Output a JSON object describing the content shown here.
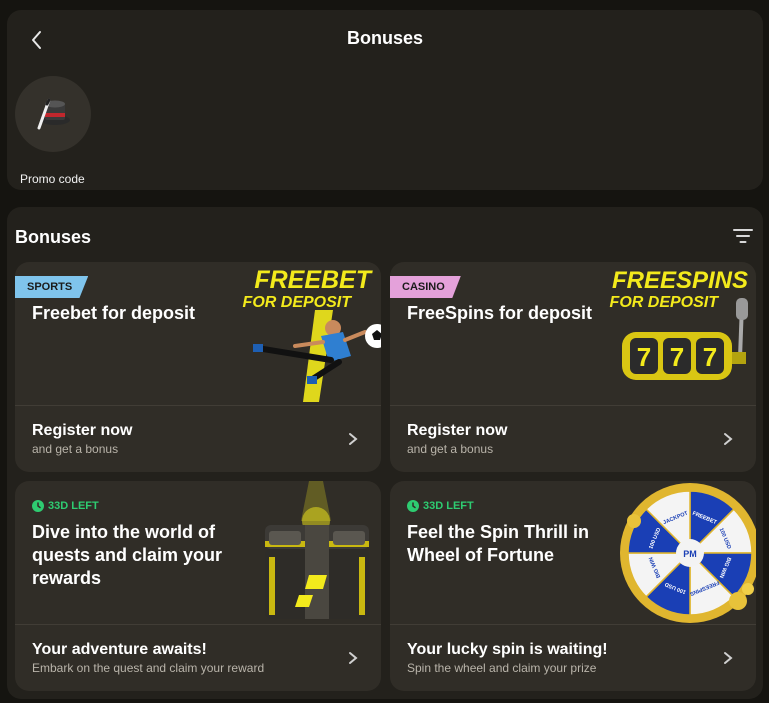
{
  "header": {
    "title": "Bonuses",
    "back_icon": "chevron-left-icon"
  },
  "quick_actions": [
    {
      "label": "Promo code",
      "icon": "magic-hat-icon"
    }
  ],
  "section": {
    "title": "Bonuses",
    "filter_icon": "filter-icon"
  },
  "colors": {
    "background": "#151410",
    "panel": "#23211c",
    "card": "#302d27",
    "accent_yellow": "#f3ea1c",
    "sports_badge": "#7fc4ec",
    "casino_badge": "#e4a1da",
    "timer_green": "#2ecc71"
  },
  "cards": [
    {
      "badge": "SPORTS",
      "title": "Freebet for deposit",
      "art_line1": "FREEBET",
      "art_line2": "FOR DEPOSIT",
      "footer_title": "Register now",
      "footer_sub": "and get a bonus"
    },
    {
      "badge": "CASINO",
      "title": "FreeSpins for deposit",
      "art_line1": "FREESPINS",
      "art_line2": "FOR DEPOSIT",
      "footer_title": "Register now",
      "footer_sub": "and get a bonus"
    },
    {
      "timer": "33D LEFT",
      "title_lines": [
        "Dive into the world of",
        "quests and claim your",
        "rewards"
      ],
      "footer_title": "Your adventure awaits!",
      "footer_sub": "Embark on the quest and claim your reward"
    },
    {
      "timer": "33D LEFT",
      "title_lines": [
        "Feel the Spin Thrill in",
        "Wheel of Fortune"
      ],
      "wheel_segments": [
        "FREEBET",
        "100 USD",
        "BIG WIN",
        "FREESPINS",
        "100 USD",
        "BIG WIN",
        "100 USD",
        "JACKPOT"
      ],
      "footer_title": "Your lucky spin is waiting!",
      "footer_sub": "Spin the wheel and claim your prize"
    }
  ]
}
